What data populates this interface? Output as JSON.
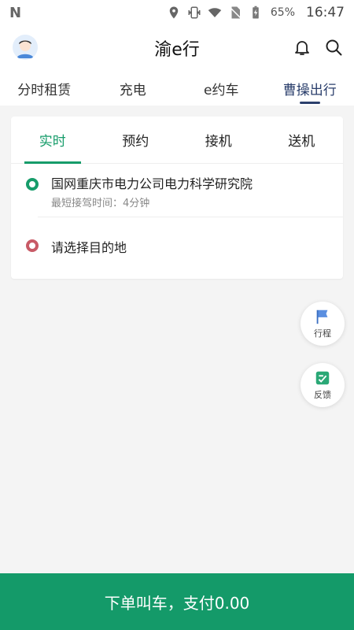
{
  "status_bar": {
    "battery_percent": "65%",
    "time": "16:47"
  },
  "header": {
    "title": "渝e行",
    "icons": [
      "avatar",
      "bell-icon",
      "search-icon"
    ]
  },
  "top_tabs": [
    {
      "label": "分时租赁",
      "active": false
    },
    {
      "label": "充电",
      "active": false
    },
    {
      "label": "e约车",
      "active": false
    },
    {
      "label": "曹操出行",
      "active": true
    }
  ],
  "sub_tabs": [
    {
      "label": "实时",
      "active": true
    },
    {
      "label": "预约",
      "active": false
    },
    {
      "label": "接机",
      "active": false
    },
    {
      "label": "送机",
      "active": false
    }
  ],
  "trip": {
    "origin": "国网重庆市电力公司电力科学研究院",
    "origin_hint": "最短接驾时间：4分钟",
    "destination_placeholder": "请选择目的地"
  },
  "floating": {
    "itinerary_label": "行程",
    "feedback_label": "反馈"
  },
  "cta": {
    "label": "下单叫车，支付0.00"
  },
  "colors": {
    "accent_green": "#149a69",
    "tab_active_blue": "#2b3f6c",
    "dest_dot_red": "#c85a66"
  }
}
